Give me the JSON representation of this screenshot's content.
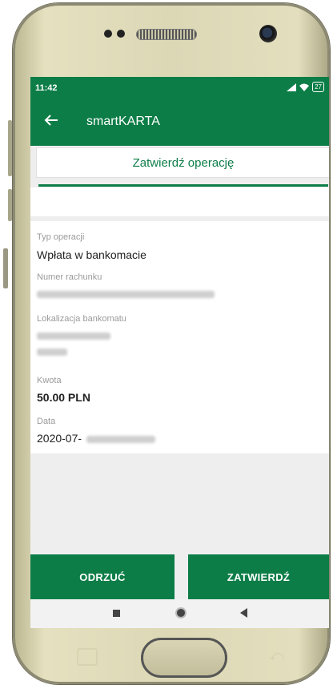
{
  "status_bar": {
    "time": "11:42",
    "battery": "27"
  },
  "app_bar": {
    "title": "smartKARTA"
  },
  "confirm": {
    "header": "Zatwierdź operację"
  },
  "details": {
    "type_label": "Typ operacji",
    "type_value": "Wpłata w bankomacie",
    "account_label": "Numer rachunku",
    "location_label": "Lokalizacja bankomatu",
    "amount_label": "Kwota",
    "amount_value": "50.00 PLN",
    "date_label": "Data",
    "date_value": "2020-07-"
  },
  "actions": {
    "reject": "ODRZUĆ",
    "approve": "ZATWIERDŹ"
  },
  "colors": {
    "brand": "#0c7d47"
  }
}
